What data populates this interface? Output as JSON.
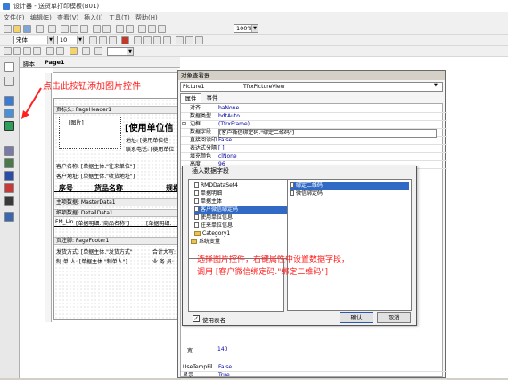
{
  "window": {
    "title": "设计器 - 送货单打印模板(B01)"
  },
  "menu": [
    "文件(F)",
    "编辑(E)",
    "查看(V)",
    "插入(I)",
    "工具(T)",
    "帮助(H)"
  ],
  "toolbar": {
    "font_name": "宋体",
    "font_size": "10",
    "zoom": "100%"
  },
  "tabs": [
    "脚本",
    "Page1"
  ],
  "report": {
    "page_header_band": "页标头: PageHeader1",
    "image_label": "[图片]",
    "company_title": "[使用单位信",
    "address": "地址: [使用单位信",
    "phone": "联系电话: [使用单位",
    "customer_name": "客户名称: [单据主体.\"往来单位\"]",
    "customer_address": "客户地址: [单据主体.\"收货地址\"]",
    "col_seq": "序号",
    "col_goods": "货品名称",
    "col_spec": "规格",
    "master_band": "主项数据: MasterData1",
    "detail_band": "细项数据: DetailData1",
    "detail_line_prefix": "FM_Lin",
    "detail_line_a": "[单据明细.\"商品名称\"]",
    "detail_line_b": "[单据明细.",
    "footer_band": "页注脚: PageFooter1",
    "footer_line1": "发货方式: [单据主体.\"发货方式\"",
    "footer_line1b": "合计大写:",
    "footer_line2": "制 单 人: [单据主体.\"制单人\"]",
    "footer_line2b": "业 务 员:"
  },
  "annotations": {
    "tip1": "点击此按钮添加图片控件",
    "tip2_line1": "选择图片控件，右键属性中设置数据字段，",
    "tip2_line2": "调用 [客户微信绑定码.\"绑定二维码\"]"
  },
  "inspector": {
    "title": "对象查看器",
    "object_name": "Picture1",
    "object_class": "TfrxPictureView",
    "tab_props": "属性",
    "tab_events": "事件",
    "props": [
      {
        "name": "对齐",
        "value": "baNone"
      },
      {
        "name": "数据类型",
        "value": "bdtAuto"
      },
      {
        "name": "边框",
        "value": "(TfrxFrame)"
      },
      {
        "name": "数据字段",
        "value": "[客户微信绑定码.\"绑定二维码\"]"
      },
      {
        "name": "直接阅读印",
        "value": "False"
      },
      {
        "name": "表达式分隔",
        "value": "[ ]"
      },
      {
        "name": "填充颜色",
        "value": "clNone"
      },
      {
        "name": "高度",
        "value": "96"
      }
    ],
    "props_bottom": [
      {
        "name": "UseTempFil",
        "value": "False"
      },
      {
        "name": "显示",
        "value": "True"
      },
      {
        "name": "宽",
        "value": "140"
      }
    ]
  },
  "dialog": {
    "title": "插入数据字段",
    "tree": [
      {
        "label": "RMDDataSet4",
        "level": 1,
        "type": "doc"
      },
      {
        "label": "单据明细",
        "level": 1,
        "type": "doc"
      },
      {
        "label": "单据主体",
        "level": 1,
        "type": "doc"
      },
      {
        "label": "客户微信绑定码",
        "level": 1,
        "type": "doc",
        "selected": true
      },
      {
        "label": "使用单位信息",
        "level": 1,
        "type": "doc"
      },
      {
        "label": "往来单位信息",
        "level": 1,
        "type": "doc"
      },
      {
        "label": "Category1",
        "level": 1,
        "type": "folder"
      },
      {
        "label": "系统变量",
        "level": 0,
        "type": "folder"
      }
    ],
    "fields": [
      {
        "label": "绑定二维码",
        "selected": true
      },
      {
        "label": "微信绑定码",
        "selected": false
      }
    ],
    "checkbox_label": "使用表名",
    "ok_label": "确认",
    "cancel_label": "取消"
  },
  "colors": {
    "accent": "#316ac5",
    "annotation": "#ff2020",
    "selection": "#316ac5"
  }
}
